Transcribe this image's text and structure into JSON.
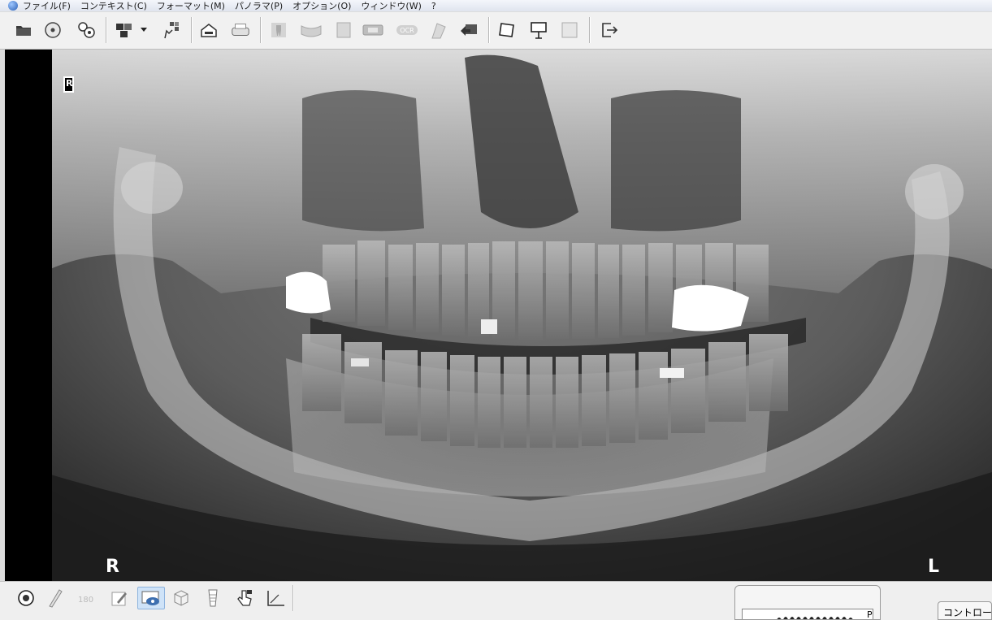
{
  "menubar": {
    "items": [
      "ファイル(F)",
      "コンテキスト(C)",
      "フォーマット(M)",
      "パノラマ(P)",
      "オプション(O)",
      "ウィンドウ(W)",
      "?"
    ]
  },
  "toolbar": {
    "icons": [
      "open-folder-icon",
      "cd-disc-icon",
      "film-reel-icon",
      "layout-icon",
      "dropdown-arrow-icon",
      "grid-select-icon",
      "scanner-icon",
      "printer-icon",
      "tooth-icon",
      "panorama-arch-icon",
      "blank-page-icon",
      "panorama-rect-icon",
      "ocr-icon",
      "tooth-curve-icon",
      "rotate-arrow-icon",
      "frame-icon",
      "presentation-icon",
      "image-icon",
      "exit-icon"
    ]
  },
  "viewer": {
    "orientation_top_marker": "R",
    "marker_right": "R",
    "marker_left": "L"
  },
  "bottombar": {
    "icons": [
      "target-icon",
      "ruler-icon",
      "rotate-180-icon",
      "edit-icon",
      "eye-view-icon",
      "3d-box-icon",
      "implant-icon",
      "hand-pointer-icon",
      "angle-icon"
    ]
  },
  "thumbnail": {
    "badge": "P"
  },
  "control_panel": {
    "label": "コントロー"
  },
  "colors": {
    "background": "#dcdcdc",
    "viewer_bg": "#000000",
    "active_button": "#cfe3f8"
  }
}
